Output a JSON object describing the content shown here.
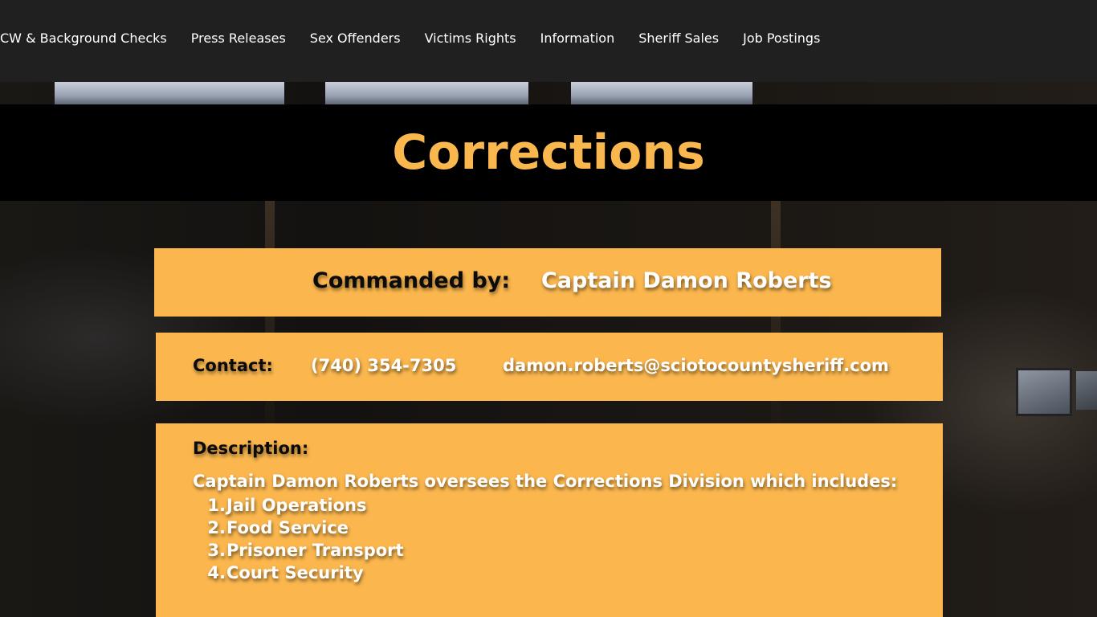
{
  "nav": {
    "items": [
      "CW & Background Checks",
      "Press Releases",
      "Sex Offenders",
      "Victims Rights",
      "Information",
      "Sheriff Sales",
      "Job Postings"
    ]
  },
  "page": {
    "title": "Corrections"
  },
  "commanded": {
    "label": "Commanded by:",
    "name": "Captain Damon Roberts"
  },
  "contact": {
    "label": "Contact:",
    "phone": "(740) 354-7305",
    "email": "damon.roberts@sciotocountysheriff.com"
  },
  "description": {
    "label": "Description:",
    "intro": "Captain Damon Roberts oversees the Corrections Division which includes:",
    "items": [
      {
        "num": "1.",
        "text": "Jail Operations"
      },
      {
        "num": "2.",
        "text": "Food Service"
      },
      {
        "num": "3.",
        "text": "Prisoner Transport"
      },
      {
        "num": "4.",
        "text": "Court Security"
      }
    ]
  },
  "colors": {
    "nav_bg": "#202020",
    "title_band_bg": "#000000",
    "title_text": "#f9b74e",
    "panel_bg": "#fbb74e"
  }
}
